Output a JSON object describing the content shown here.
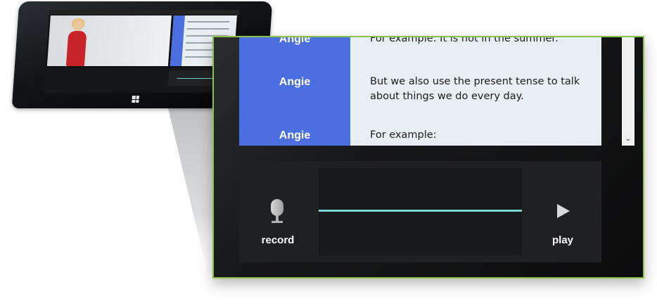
{
  "transcript": {
    "rows": [
      {
        "speaker": "Angie",
        "text": "For example: It is hot in the summer."
      },
      {
        "speaker": "Angie",
        "text": "But we also use the present tense to talk about things we do every day."
      },
      {
        "speaker": "Angie",
        "text": "For example:"
      }
    ]
  },
  "recorder": {
    "record_label": "record",
    "play_label": "play"
  },
  "colors": {
    "speaker_column": "#4b6fe0",
    "transcript_bg": "#e8eff3",
    "waveform": "#79d3d2",
    "highlight_border": "#8bc34a"
  },
  "icons": {
    "record": "microphone-icon",
    "play": "play-icon",
    "scroll": "chevron-down-icon",
    "os": "windows-logo-icon"
  }
}
